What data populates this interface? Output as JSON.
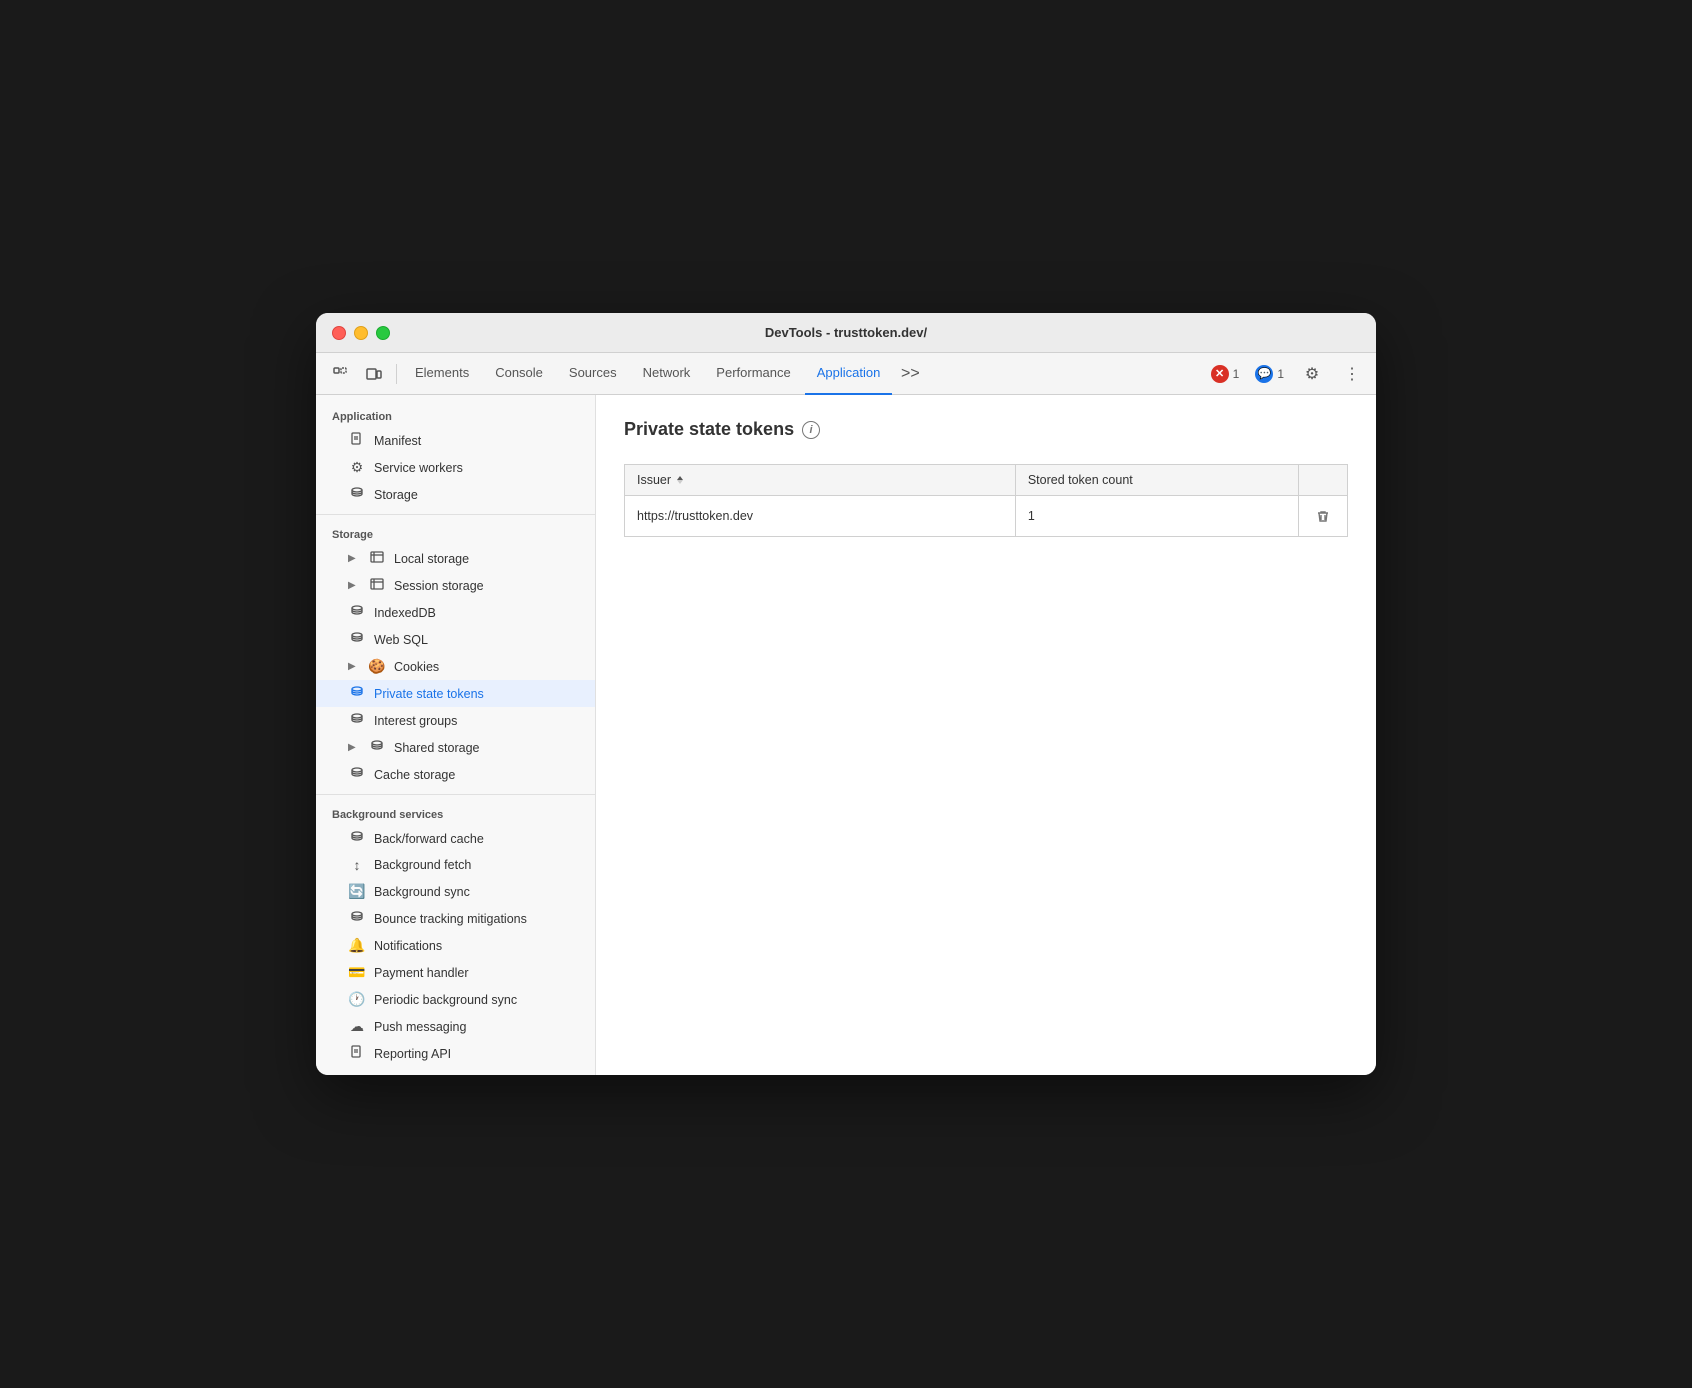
{
  "window": {
    "title": "DevTools - trusttoken.dev/"
  },
  "toolbar": {
    "tabs": [
      {
        "label": "Elements",
        "active": false
      },
      {
        "label": "Console",
        "active": false
      },
      {
        "label": "Sources",
        "active": false
      },
      {
        "label": "Network",
        "active": false
      },
      {
        "label": "Performance",
        "active": false
      },
      {
        "label": "Application",
        "active": true
      }
    ],
    "more_label": ">>",
    "error_count": "1",
    "info_count": "1"
  },
  "sidebar": {
    "section_application": "Application",
    "section_storage": "Storage",
    "section_background": "Background services",
    "items_application": [
      {
        "label": "Manifest",
        "icon": "📄",
        "indent": 1
      },
      {
        "label": "Service workers",
        "icon": "⚙",
        "indent": 1
      },
      {
        "label": "Storage",
        "icon": "🗄",
        "indent": 1
      }
    ],
    "items_storage": [
      {
        "label": "Local storage",
        "icon": "▦",
        "indent": 1,
        "expandable": true
      },
      {
        "label": "Session storage",
        "icon": "▦",
        "indent": 1,
        "expandable": true
      },
      {
        "label": "IndexedDB",
        "icon": "🗄",
        "indent": 1
      },
      {
        "label": "Web SQL",
        "icon": "🗄",
        "indent": 1
      },
      {
        "label": "Cookies",
        "icon": "🍪",
        "indent": 1,
        "expandable": true
      },
      {
        "label": "Private state tokens",
        "icon": "🗄",
        "indent": 1,
        "active": true
      },
      {
        "label": "Interest groups",
        "icon": "🗄",
        "indent": 1
      },
      {
        "label": "Shared storage",
        "icon": "🗄",
        "indent": 1,
        "expandable": true
      },
      {
        "label": "Cache storage",
        "icon": "🗄",
        "indent": 1
      }
    ],
    "items_background": [
      {
        "label": "Back/forward cache",
        "icon": "🗄",
        "indent": 1
      },
      {
        "label": "Background fetch",
        "icon": "↕",
        "indent": 1
      },
      {
        "label": "Background sync",
        "icon": "🔄",
        "indent": 1
      },
      {
        "label": "Bounce tracking mitigations",
        "icon": "🗄",
        "indent": 1
      },
      {
        "label": "Notifications",
        "icon": "🔔",
        "indent": 1
      },
      {
        "label": "Payment handler",
        "icon": "💳",
        "indent": 1
      },
      {
        "label": "Periodic background sync",
        "icon": "🕐",
        "indent": 1
      },
      {
        "label": "Push messaging",
        "icon": "☁",
        "indent": 1
      },
      {
        "label": "Reporting API",
        "icon": "📄",
        "indent": 1
      }
    ]
  },
  "main": {
    "title": "Private state tokens",
    "table": {
      "col_issuer": "Issuer",
      "col_count": "Stored token count",
      "rows": [
        {
          "issuer": "https://trusttoken.dev",
          "count": "1"
        }
      ]
    }
  }
}
